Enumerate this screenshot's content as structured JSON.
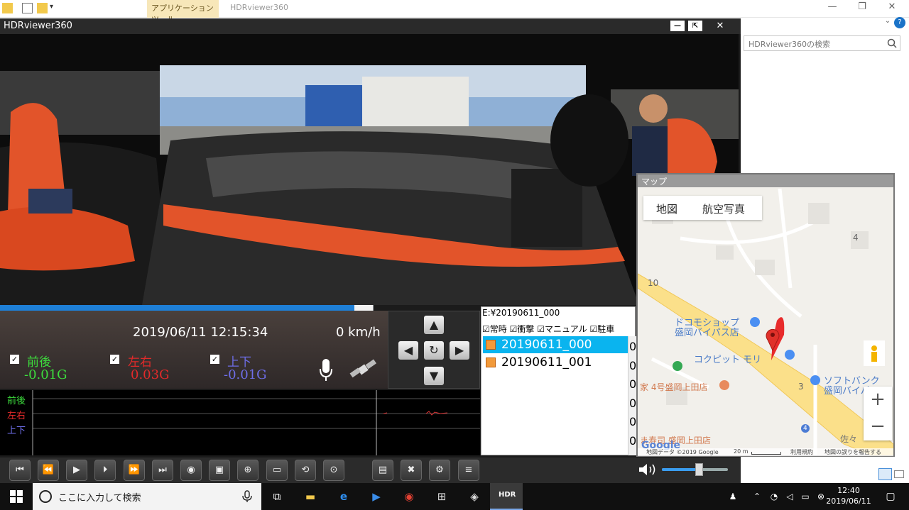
{
  "explorer": {
    "context_tab": "アプリケーション ツール",
    "window_title": "HDRviewer360",
    "search_placeholder": "HDRviewer360の検索"
  },
  "viewer": {
    "title": "HDRviewer360",
    "progress": 0.959,
    "datetime": "2019/06/11 12:15:34",
    "speed": "0 km/h",
    "gsensor": [
      {
        "label": "前後",
        "value": "-0.01G",
        "color": "#3ddc3d"
      },
      {
        "label": "左右",
        "value": "0.03G",
        "color": "#e12a2a"
      },
      {
        "label": "上下",
        "value": "-0.01G",
        "color": "#6e6ee8"
      }
    ],
    "graph_labels": [
      "前後",
      "左右",
      "上下"
    ],
    "file_path": "E:¥20190611_000",
    "filters": [
      "常時",
      "衝撃",
      "マニュアル",
      "駐車"
    ],
    "files": [
      "20190611_000",
      "20190611_001"
    ],
    "zero_col": [
      "0",
      "0",
      "0",
      "0",
      "0",
      "0"
    ]
  },
  "map": {
    "title": "マップ",
    "type_map": "地図",
    "type_aerial": "航空写真",
    "labels": [
      "ドコモショップ",
      "盛岡バイパス店",
      "コクピット モリ",
      "ソフトバンク",
      "盛岡バイパ",
      "家 4号盛岡上田店",
      "ま寿司 盛岡上田店",
      "佐々",
      "10",
      "4",
      "3",
      "4"
    ],
    "footer": "地図データ ©2019 Google",
    "scale": "20 m",
    "terms": "利用規約",
    "report": "地図の誤りを報告する",
    "google": "Google"
  },
  "taskbar": {
    "search": "ここに入力して検索",
    "time": "12:40",
    "date": "2019/06/11",
    "hdr_label": "HDR"
  }
}
